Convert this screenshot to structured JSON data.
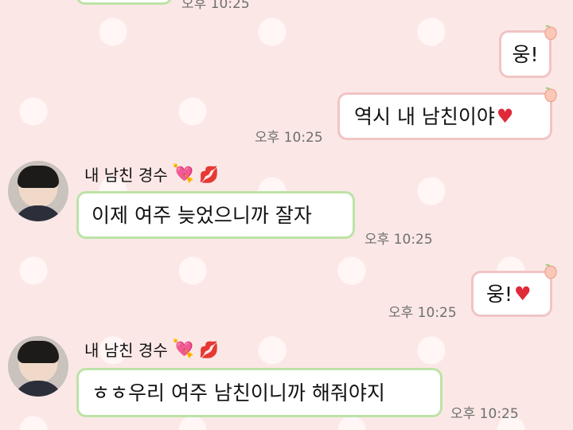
{
  "messages": {
    "top_partial_time": "오후 10:25",
    "m1_text": "웅!",
    "m2_text": "역시 내 남친이야",
    "m2_time": "오후 10:25",
    "sender_name": "내 남친 경수",
    "m3_text": "이제 여주 늦었으니까 잘자",
    "m3_time": "오후 10:25",
    "m4_text": "웅!",
    "m4_time": "오후 10:25",
    "m5_text": "ㅎㅎ우리 여주 남친이니까 해줘야지",
    "m5_time": "오후 10:25"
  },
  "icons": {
    "heart": "heart-icon",
    "heart_arrow": "heart-with-arrow-icon",
    "kiss": "kiss-mark-icon",
    "peach": "peach-decoration-icon"
  },
  "colors": {
    "background": "#fbe8e6",
    "my_bubble_border": "#f1c4c4",
    "their_bubble_border": "#bde3a6",
    "heart": "#e02a3a"
  }
}
